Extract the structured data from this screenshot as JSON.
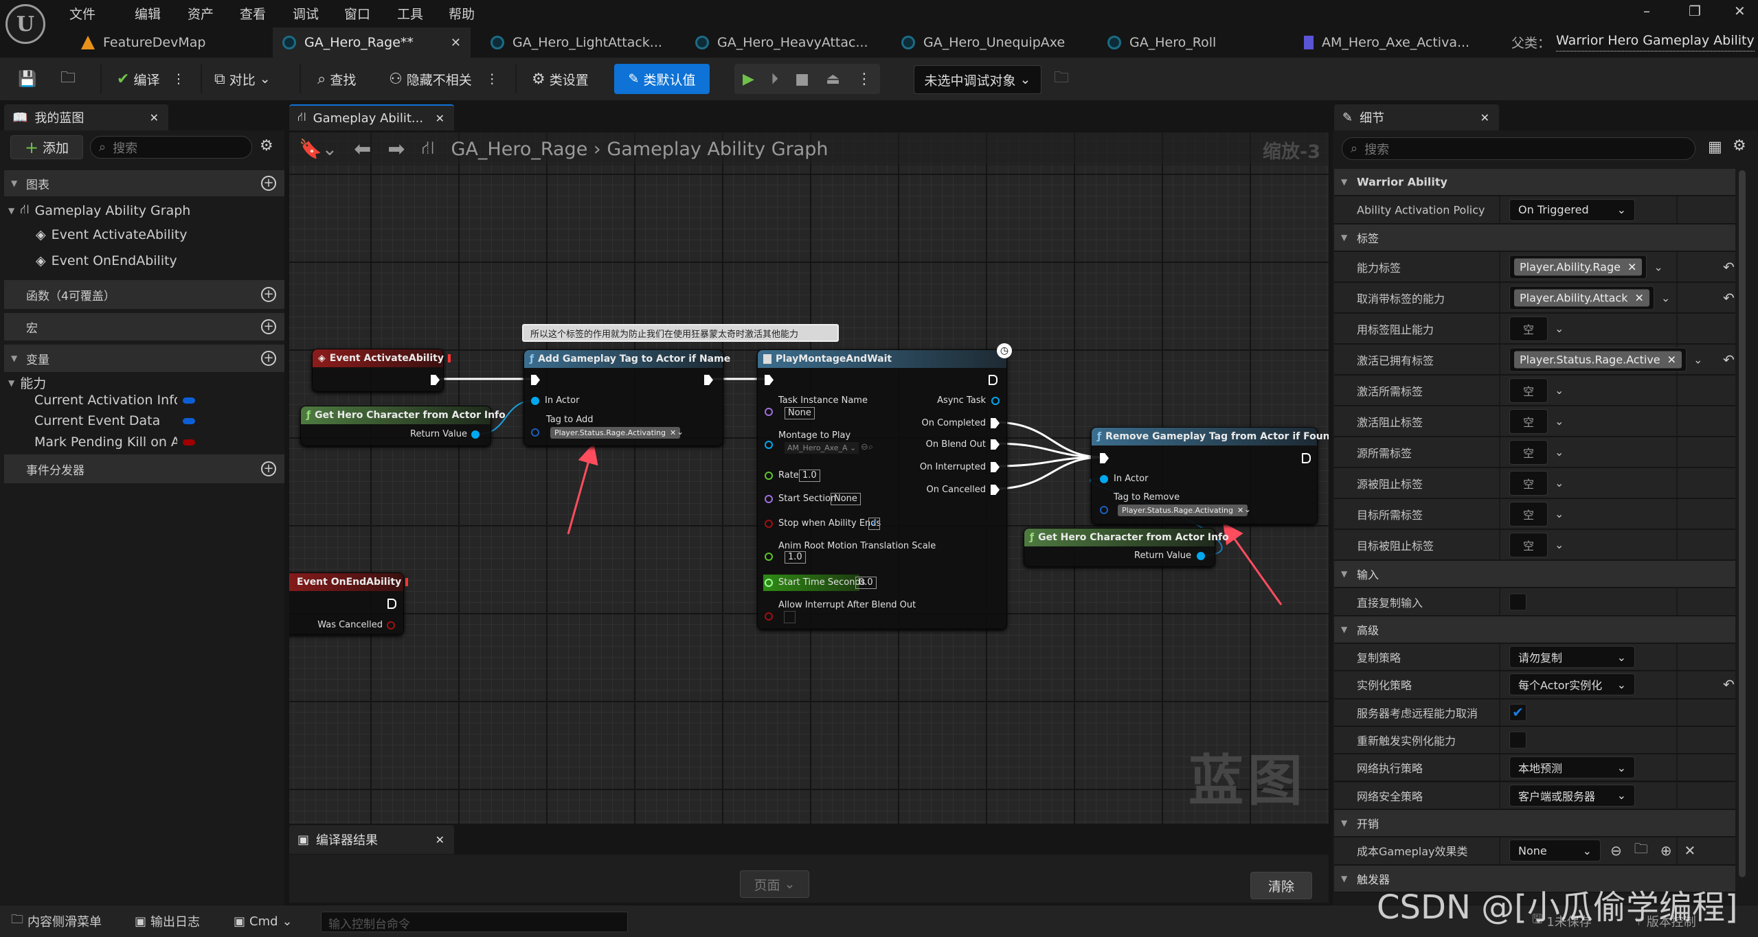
{
  "menu": [
    "文件",
    "编辑",
    "资产",
    "查看",
    "调试",
    "窗口",
    "工具",
    "帮助"
  ],
  "tabs": [
    {
      "label": "FeatureDevMap",
      "icon": "level-map-icon"
    },
    {
      "label": "GA_Hero_Rage**",
      "icon": "blueprint-icon",
      "active": true
    },
    {
      "label": "GA_Hero_LightAttack...",
      "icon": "blueprint-icon"
    },
    {
      "label": "GA_Hero_HeavyAttac...",
      "icon": "blueprint-icon"
    },
    {
      "label": "GA_Hero_UnequipAxe",
      "icon": "blueprint-icon"
    },
    {
      "label": "GA_Hero_Roll",
      "icon": "blueprint-icon"
    },
    {
      "label": "AM_Hero_Axe_Activa...",
      "icon": "anim-montage-icon"
    }
  ],
  "parent_class": {
    "label": "父类：",
    "value": "Warrior Hero Gameplay Ability"
  },
  "toolbar": {
    "compile": "编译",
    "diff": "对比",
    "find": "查找",
    "hide_unrelated": "隐藏不相关",
    "class_settings": "类设置",
    "class_defaults": "类默认值",
    "debug_object": "未选中调试对象"
  },
  "my_blueprint": {
    "tab": "我的蓝图",
    "add": "添加",
    "search_placeholder": "搜索",
    "graphs_header": "图表",
    "graph_name": "Gameplay Ability Graph",
    "events": [
      "Event ActivateAbility",
      "Event OnEndAbility"
    ],
    "functions_header": "函数（4可覆盖）",
    "macros_header": "宏",
    "variables_header": "变量",
    "var_category": "能力",
    "variables": [
      {
        "name": "Current Activation Info",
        "color": "#0d5fd6"
      },
      {
        "name": "Current Event Data",
        "color": "#0d5fd6"
      },
      {
        "name": "Mark Pending Kill on Ab",
        "color": "#a00000"
      }
    ],
    "dispatchers_header": "事件分发器"
  },
  "graph": {
    "tab": "Gameplay Abilit...",
    "breadcrumb": [
      "GA_Hero_Rage",
      "Gameplay Ability Graph"
    ],
    "zoom": "缩放-3",
    "watermark": "蓝图",
    "comment": "所以这个标签的作用就为防止我们在使用狂暴蒙太奇时激活其他能力",
    "nodes": {
      "event_activate": {
        "title": "Event ActivateAbility"
      },
      "get_hero_1": {
        "title": "Get Hero Character from Actor Info",
        "return": "Return Value"
      },
      "add_tag": {
        "title": "Add Gameplay Tag to Actor if Name",
        "in_actor": "In Actor",
        "tag_label": "Tag to Add",
        "tag": "Player.Status.Rage.Activating"
      },
      "montage": {
        "title": "PlayMontageAndWait",
        "task_name": "Task Instance Name",
        "task_value": "None",
        "async": "Async Task",
        "montage": "Montage to Play",
        "montage_value": "AM_Hero_Axe_A",
        "on_completed": "On Completed",
        "on_blend_out": "On Blend Out",
        "on_interrupted": "On Interrupted",
        "on_cancelled": "On Cancelled",
        "rate": "Rate",
        "rate_value": "1.0",
        "start_section": "Start Section",
        "start_section_value": "None",
        "stop": "Stop when Ability Ends",
        "stop_checked": true,
        "anim_root": "Anim Root Motion Translation Scale",
        "anim_root_value": "1.0",
        "start_time": "Start Time Seconds",
        "start_time_value": "0.0",
        "allow_interrupt": "Allow Interrupt After Blend Out",
        "allow_interrupt_checked": false
      },
      "remove_tag": {
        "title": "Remove Gameplay Tag from Actor if Found",
        "in_actor": "In Actor",
        "tag_label": "Tag to Remove",
        "tag": "Player.Status.Rage.Activating"
      },
      "get_hero_2": {
        "title": "Get Hero Character from Actor Info",
        "return": "Return Value"
      },
      "event_end": {
        "title": "Event OnEndAbility",
        "was_cancelled": "Was Cancelled"
      }
    }
  },
  "compiler": {
    "tab": "编译器结果",
    "page": "页面",
    "clear": "清除"
  },
  "details": {
    "tab": "细节",
    "search_placeholder": "搜索",
    "sections": [
      {
        "title": "Warrior Ability",
        "rows": [
          {
            "label": "Ability Activation Policy",
            "type": "dropdown",
            "value": "On Triggered"
          }
        ]
      },
      {
        "title": "标签",
        "rows": [
          {
            "label": "能力标签",
            "type": "tag",
            "value": "Player.Ability.Rage",
            "reset": true
          },
          {
            "label": "取消带标签的能力",
            "type": "tag",
            "value": "Player.Ability.Attack",
            "reset": true
          },
          {
            "label": "用标签阻止能力",
            "type": "empty",
            "value": "空"
          },
          {
            "label": "激活已拥有标签",
            "type": "tag",
            "value": "Player.Status.Rage.Active",
            "reset": true
          },
          {
            "label": "激活所需标签",
            "type": "empty",
            "value": "空"
          },
          {
            "label": "激活阻止标签",
            "type": "empty",
            "value": "空"
          },
          {
            "label": "源所需标签",
            "type": "empty",
            "value": "空"
          },
          {
            "label": "源被阻止标签",
            "type": "empty",
            "value": "空"
          },
          {
            "label": "目标所需标签",
            "type": "empty",
            "value": "空"
          },
          {
            "label": "目标被阻止标签",
            "type": "empty",
            "value": "空"
          }
        ]
      },
      {
        "title": "输入",
        "rows": [
          {
            "label": "直接复制输入",
            "type": "checkbox",
            "value": false
          }
        ]
      },
      {
        "title": "高级",
        "rows": [
          {
            "label": "复制策略",
            "type": "dropdown",
            "value": "请勿复制"
          },
          {
            "label": "实例化策略",
            "type": "dropdown",
            "value": "每个Actor实例化",
            "reset": true
          },
          {
            "label": "服务器考虑远程能力取消",
            "type": "checkbox",
            "value": true
          },
          {
            "label": "重新触发实例化能力",
            "type": "checkbox",
            "value": false
          },
          {
            "label": "网络执行策略",
            "type": "dropdown",
            "value": "本地预测"
          },
          {
            "label": "网络安全策略",
            "type": "dropdown",
            "value": "客户端或服务器"
          }
        ]
      },
      {
        "title": "开销",
        "rows": [
          {
            "label": "成本Gameplay效果类",
            "type": "asset",
            "value": "None"
          }
        ]
      },
      {
        "title": "触发器",
        "rows": []
      }
    ]
  },
  "status_bar": {
    "content_drawer": "内容侧滑菜单",
    "output_log": "输出日志",
    "cmd": "Cmd",
    "cmd_placeholder": "输入控制台命令",
    "unsaved": "1未保存",
    "source_control": "版本控制"
  },
  "watermark": "CSDN @[小瓜偷学编程]",
  "colors": {
    "accent": "#0e72d6",
    "event_header": "#8c1c1c",
    "pure_function_header": "#4e7a40",
    "function_header": "#3c6e8e",
    "object_pin": "#00a8f0",
    "exec_wire": "#ffffff",
    "annotation_arrow": "#ff4d5e"
  }
}
